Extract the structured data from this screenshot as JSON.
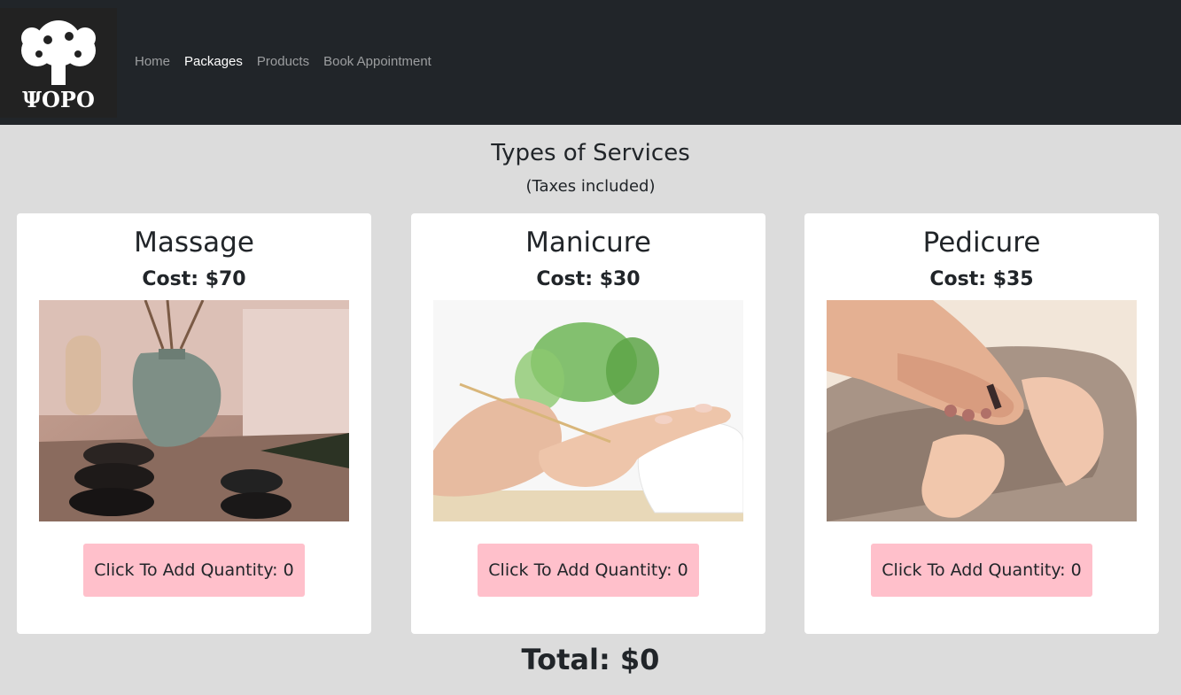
{
  "nav": {
    "logo_alt": "ΨΟΡΟ",
    "links": [
      {
        "label": "Home",
        "active": false
      },
      {
        "label": "Packages",
        "active": true
      },
      {
        "label": "Products",
        "active": false
      },
      {
        "label": "Book Appointment",
        "active": false
      }
    ]
  },
  "heading": {
    "title": "Types of Services",
    "subtitle": "(Taxes included)"
  },
  "services": [
    {
      "name": "Massage",
      "cost": "Cost: $70",
      "button": "Click To Add Quantity: 0",
      "image": "massage-spa-photo"
    },
    {
      "name": "Manicure",
      "cost": "Cost: $30",
      "button": "Click To Add Quantity: 0",
      "image": "manicure-photo"
    },
    {
      "name": "Pedicure",
      "cost": "Cost: $35",
      "button": "Click To Add Quantity: 0",
      "image": "pedicure-photo"
    }
  ],
  "total": "Total: $0",
  "colors": {
    "navbar": "#212529",
    "background": "#dcdcdc",
    "button": "#ffc0cb"
  }
}
